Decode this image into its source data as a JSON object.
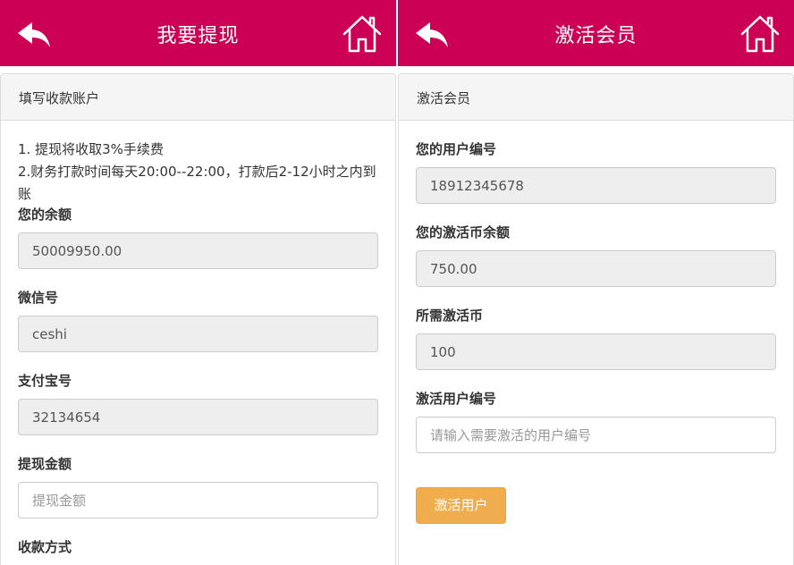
{
  "left_screen": {
    "header": {
      "title": "我要提现",
      "back_icon": "back-arrow-icon",
      "home_icon": "home-icon"
    },
    "panel": {
      "heading": "填写收款账户",
      "notice": [
        "1. 提现将收取3%手续费",
        "2.财务打款时间每天20:00--22:00，打款后2-12小时之内到账"
      ],
      "balance": {
        "label": "您的余额",
        "value": "50009950.00"
      },
      "wechat": {
        "label": "微信号",
        "value": "ceshi"
      },
      "alipay": {
        "label": "支付宝号",
        "value": "32134654"
      },
      "amount": {
        "label": "提现金额",
        "placeholder": "提现金额"
      },
      "method": {
        "label": "收款方式"
      }
    }
  },
  "right_screen": {
    "header": {
      "title": "激活会员",
      "back_icon": "back-arrow-icon",
      "home_icon": "home-icon"
    },
    "panel": {
      "heading": "激活会员",
      "user_id": {
        "label": "您的用户编号",
        "value": "18912345678"
      },
      "coin_balance": {
        "label": "您的激活币余额",
        "value": "750.00"
      },
      "required_coins": {
        "label": "所需激活币",
        "value": "100"
      },
      "target_user": {
        "label": "激活用户编号",
        "placeholder": "请输入需要激活的用户编号"
      },
      "submit_label": "激活用户"
    }
  },
  "colors": {
    "header": "#cc0055",
    "button": "#f0ad4e",
    "readonly_bg": "#eeeeee",
    "panel_head_bg": "#f5f5f5"
  }
}
